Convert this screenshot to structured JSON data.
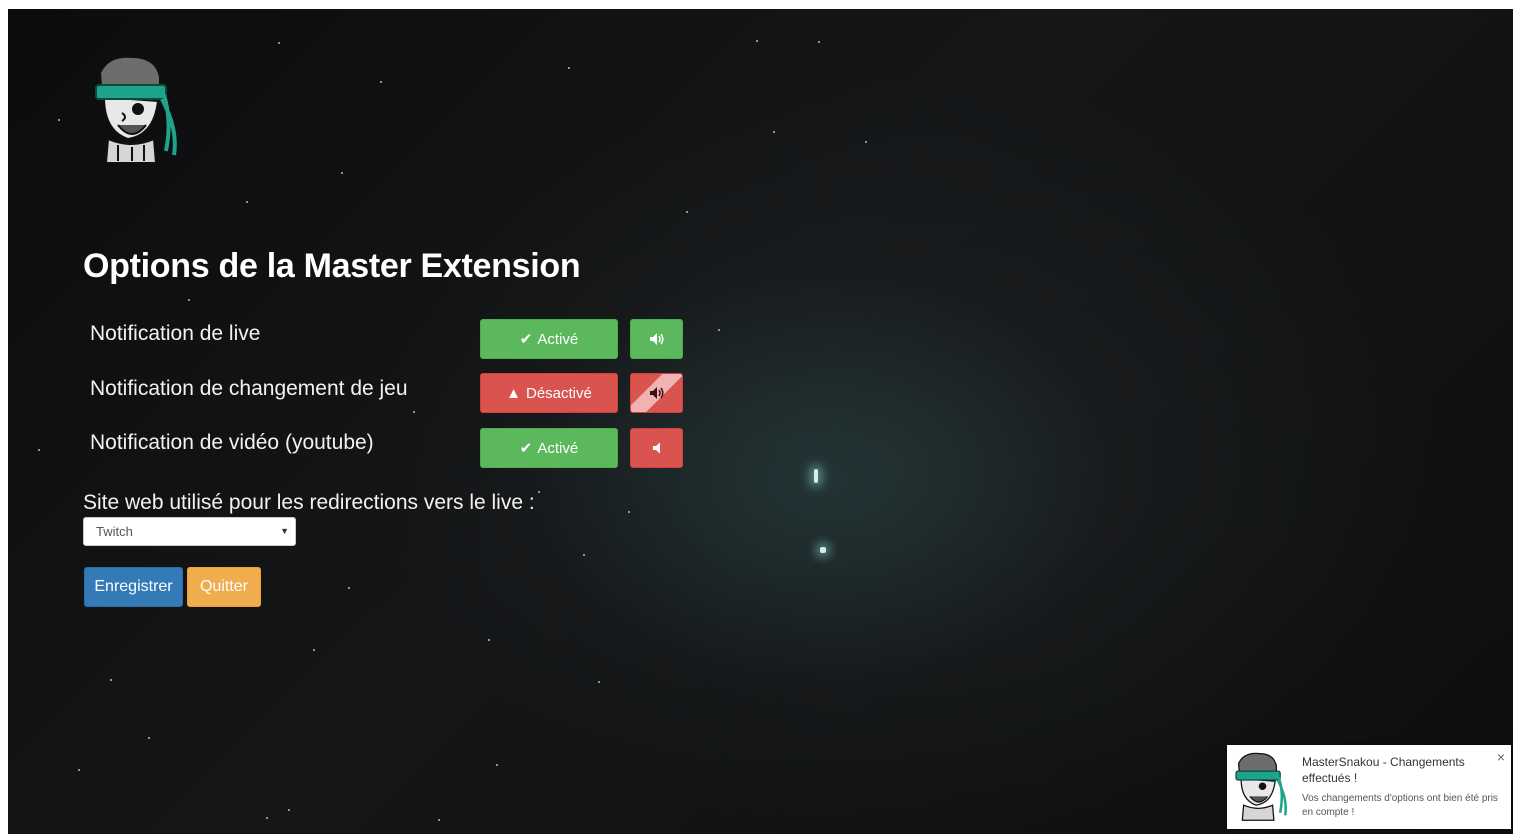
{
  "page": {
    "title": "Options de la Master Extension"
  },
  "options": [
    {
      "label": "Notification de live",
      "state_label": "Activé",
      "state": "enabled",
      "sound": "on"
    },
    {
      "label": "Notification de changement de jeu",
      "state_label": "Désactivé",
      "state": "disabled",
      "sound": "on-disabled"
    },
    {
      "label": "Notification de vidéo (youtube)",
      "state_label": "Activé",
      "state": "enabled",
      "sound": "off"
    }
  ],
  "site": {
    "label": "Site web utilisé pour les redirections vers le live :",
    "selected": "Twitch"
  },
  "actions": {
    "save_label": "Enregistrer",
    "quit_label": "Quitter"
  },
  "toast": {
    "title": "MasterSnakou - Changements effectués !",
    "body": "Vos changements d'options ont bien été pris en compte !",
    "close": "×"
  },
  "colors": {
    "enabled": "#5cb85c",
    "disabled": "#d9534f",
    "save": "#337ab7",
    "quit": "#f0ad4e"
  }
}
